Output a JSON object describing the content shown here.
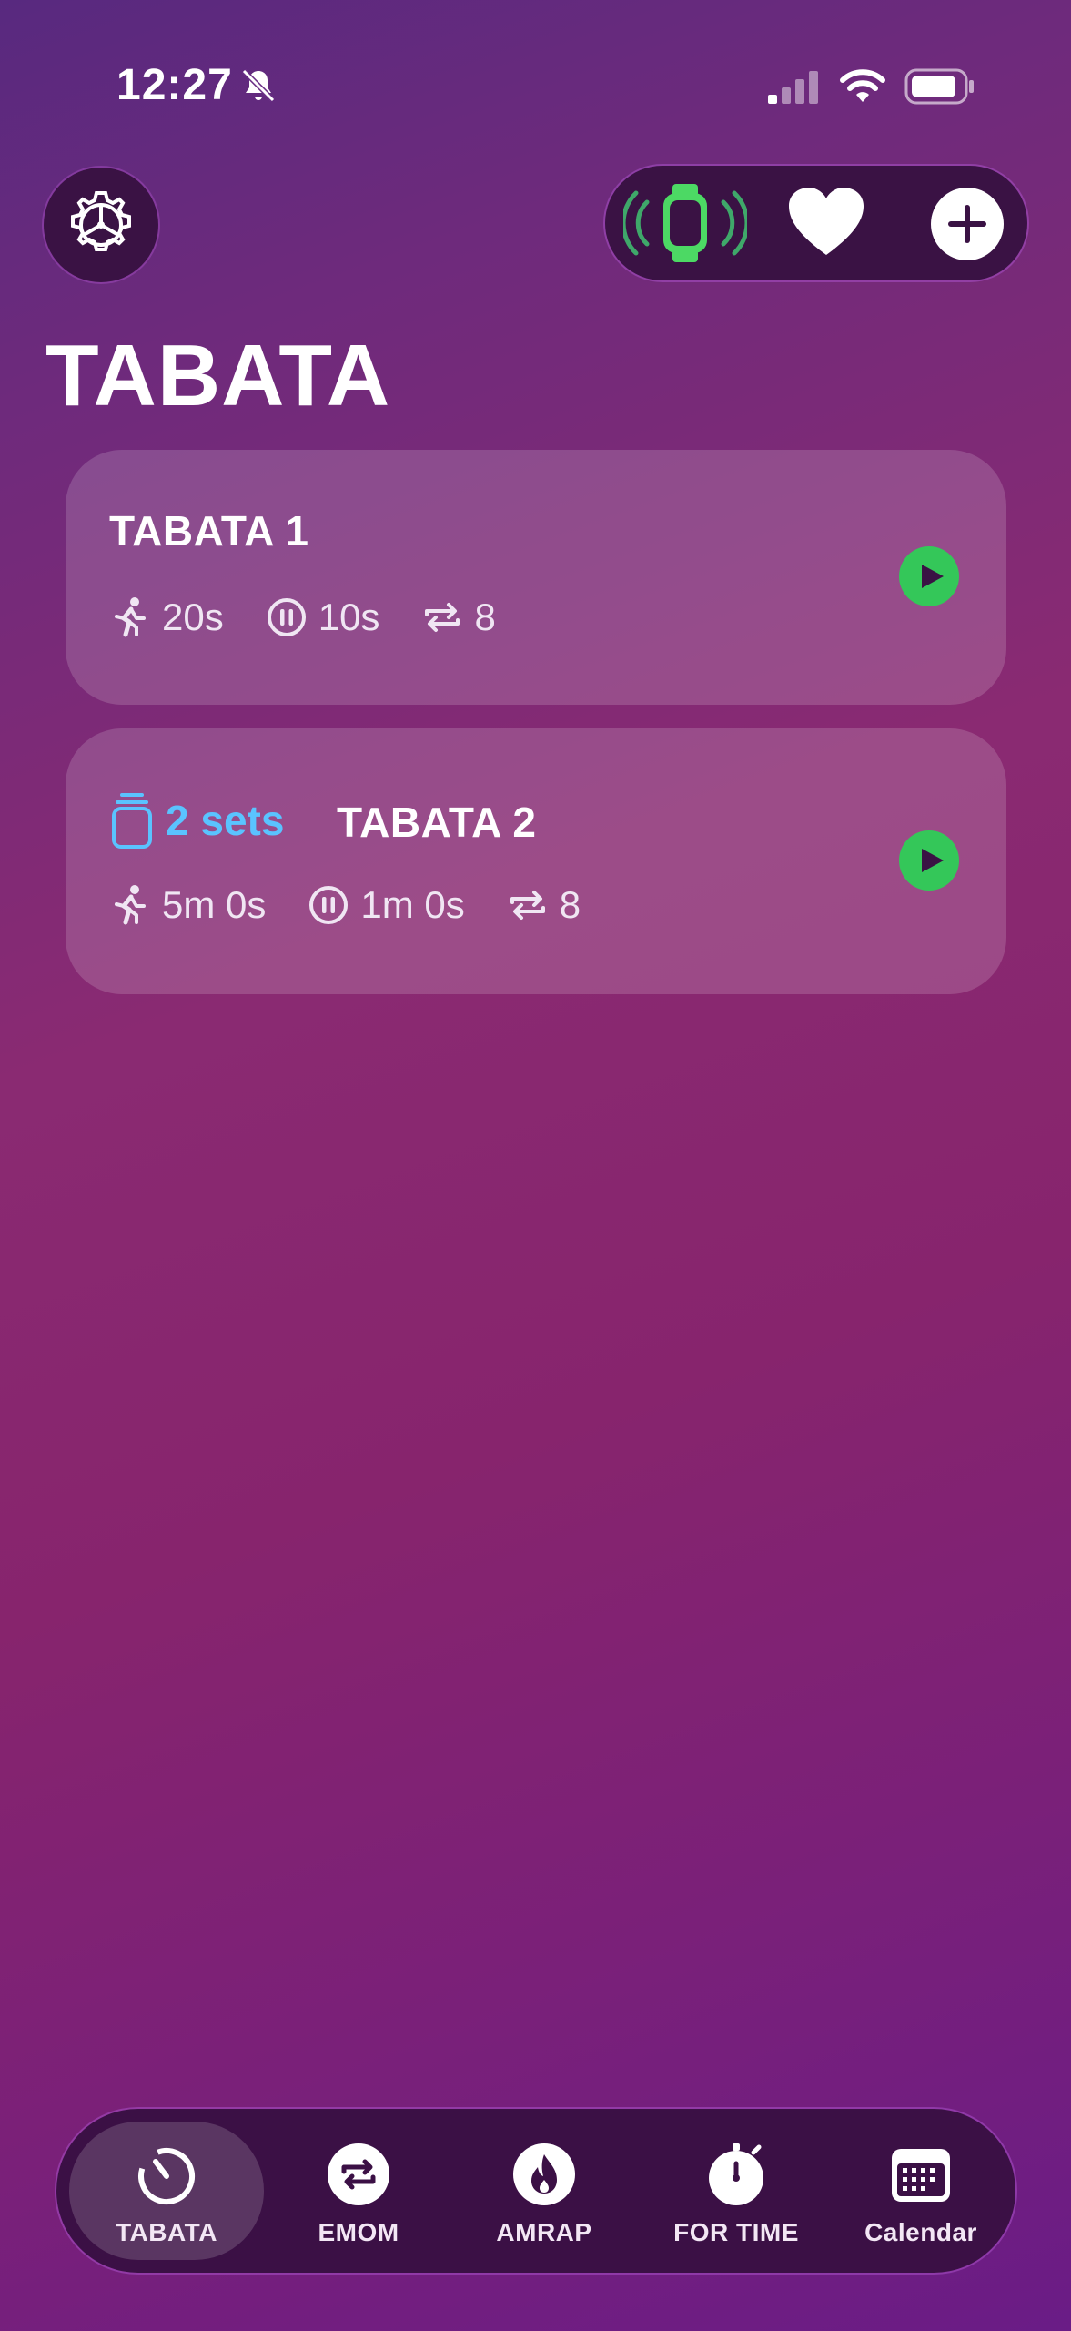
{
  "status_bar": {
    "time": "12:27",
    "icons": [
      "bell-slash-icon",
      "signal-icon",
      "wifi-icon",
      "battery-icon"
    ]
  },
  "header": {
    "settings_icon": "gear-icon",
    "watch_icon": "apple-watch-icon",
    "favorites_icon": "heart-icon",
    "add_icon": "plus-icon",
    "title": "TABATA"
  },
  "workouts": [
    {
      "title": "TABATA 1",
      "work": "20s",
      "rest": "10s",
      "rounds": "8"
    },
    {
      "sets": "2 sets",
      "title": "TABATA 2",
      "work": "5m 0s",
      "rest": "1m 0s",
      "rounds": "8"
    }
  ],
  "tabs": [
    {
      "label": "TABATA",
      "icon": "timer-dial-icon",
      "active": true
    },
    {
      "label": "EMOM",
      "icon": "repeat-icon",
      "active": false
    },
    {
      "label": "AMRAP",
      "icon": "flame-icon",
      "active": false
    },
    {
      "label": "FOR TIME",
      "icon": "stopwatch-icon",
      "active": false
    },
    {
      "label": "Calendar",
      "icon": "calendar-icon",
      "active": false
    }
  ],
  "colors": {
    "accent_green": "#34c759",
    "sets_blue": "#5ac3ff",
    "watch_green": "#4cd964",
    "pill_background": "#3a1244"
  }
}
